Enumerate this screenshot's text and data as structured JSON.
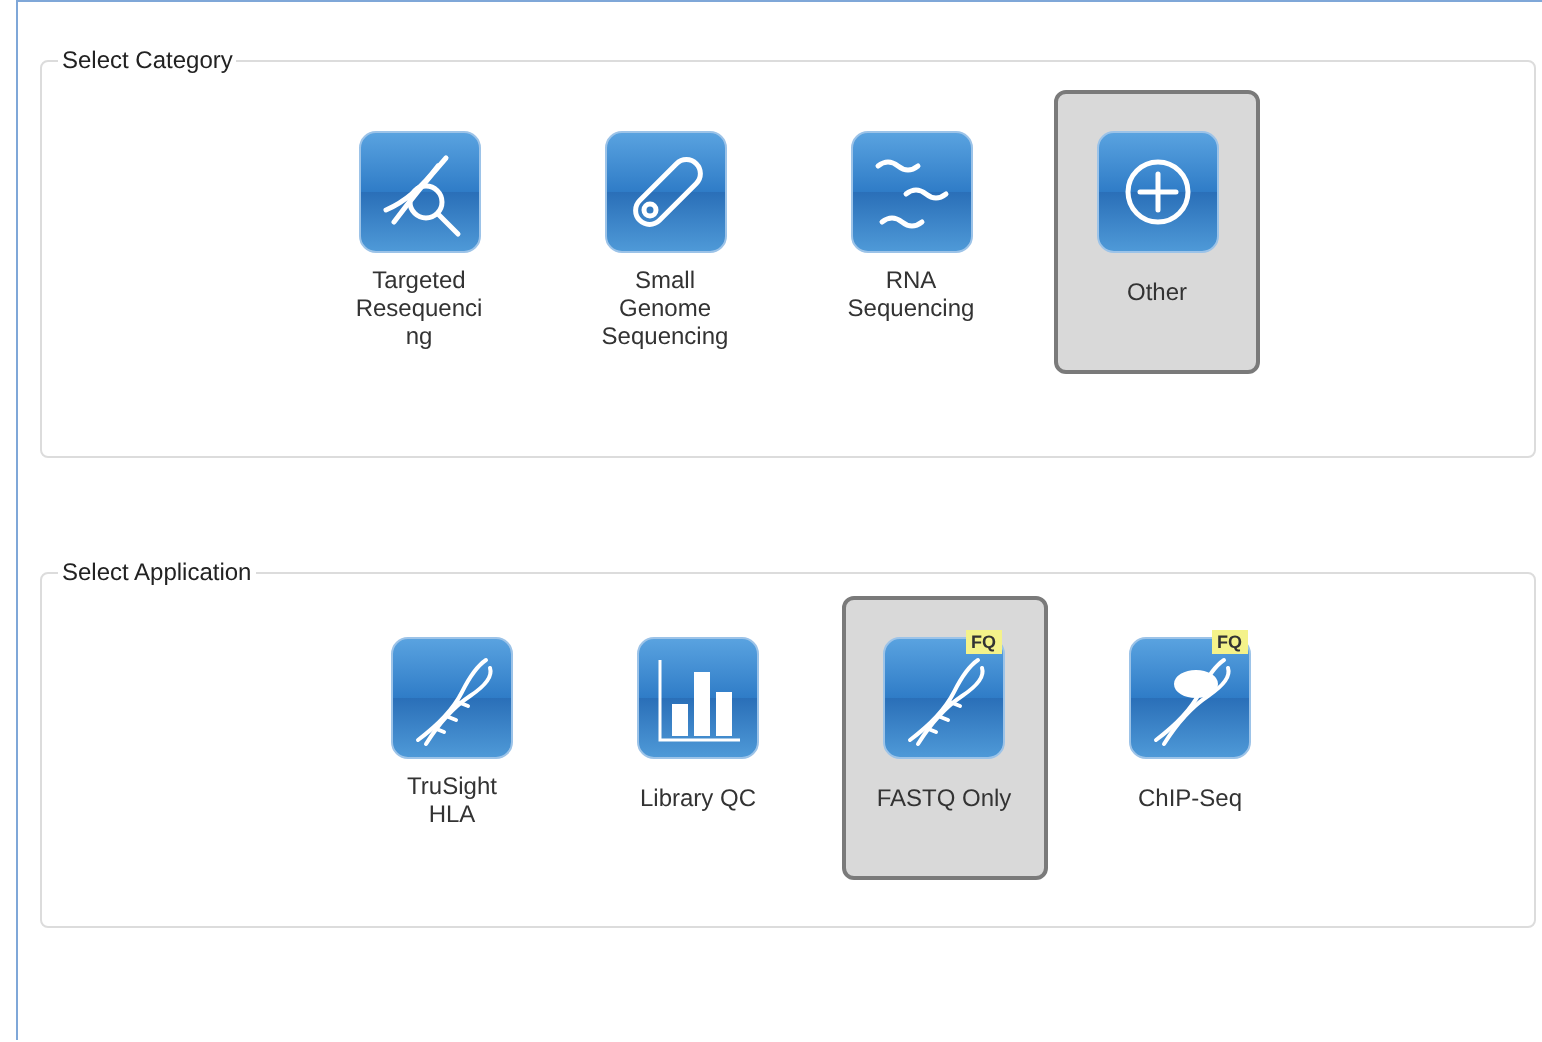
{
  "groups": [
    {
      "title": "Select Category",
      "items": [
        {
          "label": "Targeted Resequencing",
          "kind": "dna-search",
          "selected": false
        },
        {
          "label": "Small Genome Sequencing",
          "kind": "capsule",
          "selected": false
        },
        {
          "label": "RNA Sequencing",
          "kind": "waves",
          "selected": false
        },
        {
          "label": "Other",
          "kind": "plus",
          "selected": true
        }
      ]
    },
    {
      "title": "Select Application",
      "items": [
        {
          "label": "TruSight HLA",
          "kind": "dna",
          "selected": false
        },
        {
          "label": "Library QC",
          "kind": "bars",
          "selected": false
        },
        {
          "label": "FASTQ Only",
          "kind": "dna",
          "badge": "FQ",
          "selected": true
        },
        {
          "label": "ChIP-Seq",
          "kind": "dna-cloud",
          "badge": "FQ",
          "selected": false
        }
      ]
    }
  ]
}
